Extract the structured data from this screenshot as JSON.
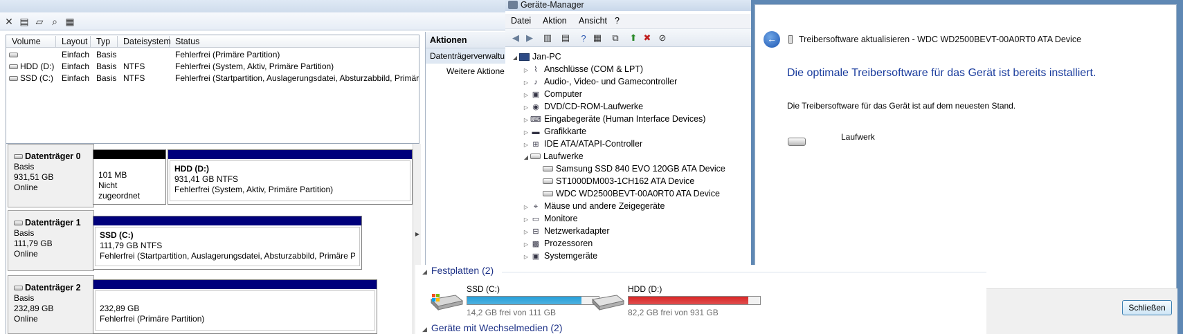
{
  "disk_management": {
    "columns": [
      "Volume",
      "Layout",
      "Typ",
      "Dateisystem",
      "Status"
    ],
    "volumes": [
      {
        "volume": "",
        "layout": "Einfach",
        "type": "Basis",
        "fs": "",
        "status": "Fehlerfrei (Primäre Partition)"
      },
      {
        "volume": "HDD (D:)",
        "layout": "Einfach",
        "type": "Basis",
        "fs": "NTFS",
        "status": "Fehlerfrei (System, Aktiv, Primäre Partition)"
      },
      {
        "volume": "SSD (C:)",
        "layout": "Einfach",
        "type": "Basis",
        "fs": "NTFS",
        "status": "Fehlerfrei (Startpartition, Auslagerungsdatei, Absturzabbild, Primäre"
      }
    ],
    "disks": [
      {
        "title": "Datenträger 0",
        "type": "Basis",
        "size": "931,51 GB",
        "state": "Online",
        "partitions": [
          {
            "name": "",
            "line1": "101 MB",
            "line2": "Nicht zugeordnet",
            "bar": "#000000"
          },
          {
            "name": "HDD  (D:)",
            "line1": "931,41 GB NTFS",
            "line2": "Fehlerfrei (System, Aktiv, Primäre Partition)",
            "bar": "#00007b"
          }
        ]
      },
      {
        "title": "Datenträger 1",
        "type": "Basis",
        "size": "111,79 GB",
        "state": "Online",
        "partitions": [
          {
            "name": "SSD  (C:)",
            "line1": "111,79 GB NTFS",
            "line2": "Fehlerfrei (Startpartition, Auslagerungsdatei, Absturzabbild, Primäre P",
            "bar": "#00007b"
          }
        ]
      },
      {
        "title": "Datenträger 2",
        "type": "Basis",
        "size": "232,89 GB",
        "state": "Online",
        "partitions": [
          {
            "name": "",
            "line1": "232,89 GB",
            "line2": "Fehlerfrei (Primäre Partition)",
            "bar": "#00007b"
          }
        ]
      }
    ],
    "actions": {
      "header": "Aktionen",
      "selected": "Datenträgerverwaltu",
      "more": "Weitere Aktione"
    }
  },
  "device_manager": {
    "title": "Geräte-Manager",
    "menu": [
      "Datei",
      "Aktion",
      "Ansicht",
      "?"
    ],
    "root": "Jan-PC",
    "categories": [
      "Anschlüsse (COM & LPT)",
      "Audio-, Video- und Gamecontroller",
      "Computer",
      "DVD/CD-ROM-Laufwerke",
      "Eingabegeräte (Human Interface Devices)",
      "Grafikkarte",
      "IDE ATA/ATAPI-Controller",
      "Laufwerke",
      "Mäuse und andere Zeigegeräte",
      "Monitore",
      "Netzwerkadapter",
      "Prozessoren",
      "Systemgeräte"
    ],
    "drives": [
      "Samsung SSD 840 EVO 120GB ATA Device",
      "ST1000DM003-1CH162 ATA Device",
      "WDC WD2500BEVT-00A0RT0 ATA Device"
    ]
  },
  "computer": {
    "section1": "Festplatten (2)",
    "section2": "Geräte mit Wechselmedien (2)",
    "drives": [
      {
        "name": "SSD (C:)",
        "free": "14,2 GB frei von 111 GB",
        "used_fraction": 0.87,
        "color": "#26a0da"
      },
      {
        "name": "HDD (D:)",
        "free": "82,2 GB frei von 931 GB",
        "used_fraction": 0.91,
        "color": "#da2626"
      }
    ]
  },
  "dialog": {
    "title": "Treibersoftware aktualisieren - WDC WD2500BEVT-00A0RT0 ATA Device",
    "heading": "Die optimale Treibersoftware für das Gerät ist bereits installiert.",
    "subtext": "Die Treibersoftware für das Gerät ist auf dem neuesten Stand.",
    "device": "Laufwerk",
    "close_button": "Schließen",
    "close_glyph": "×"
  }
}
